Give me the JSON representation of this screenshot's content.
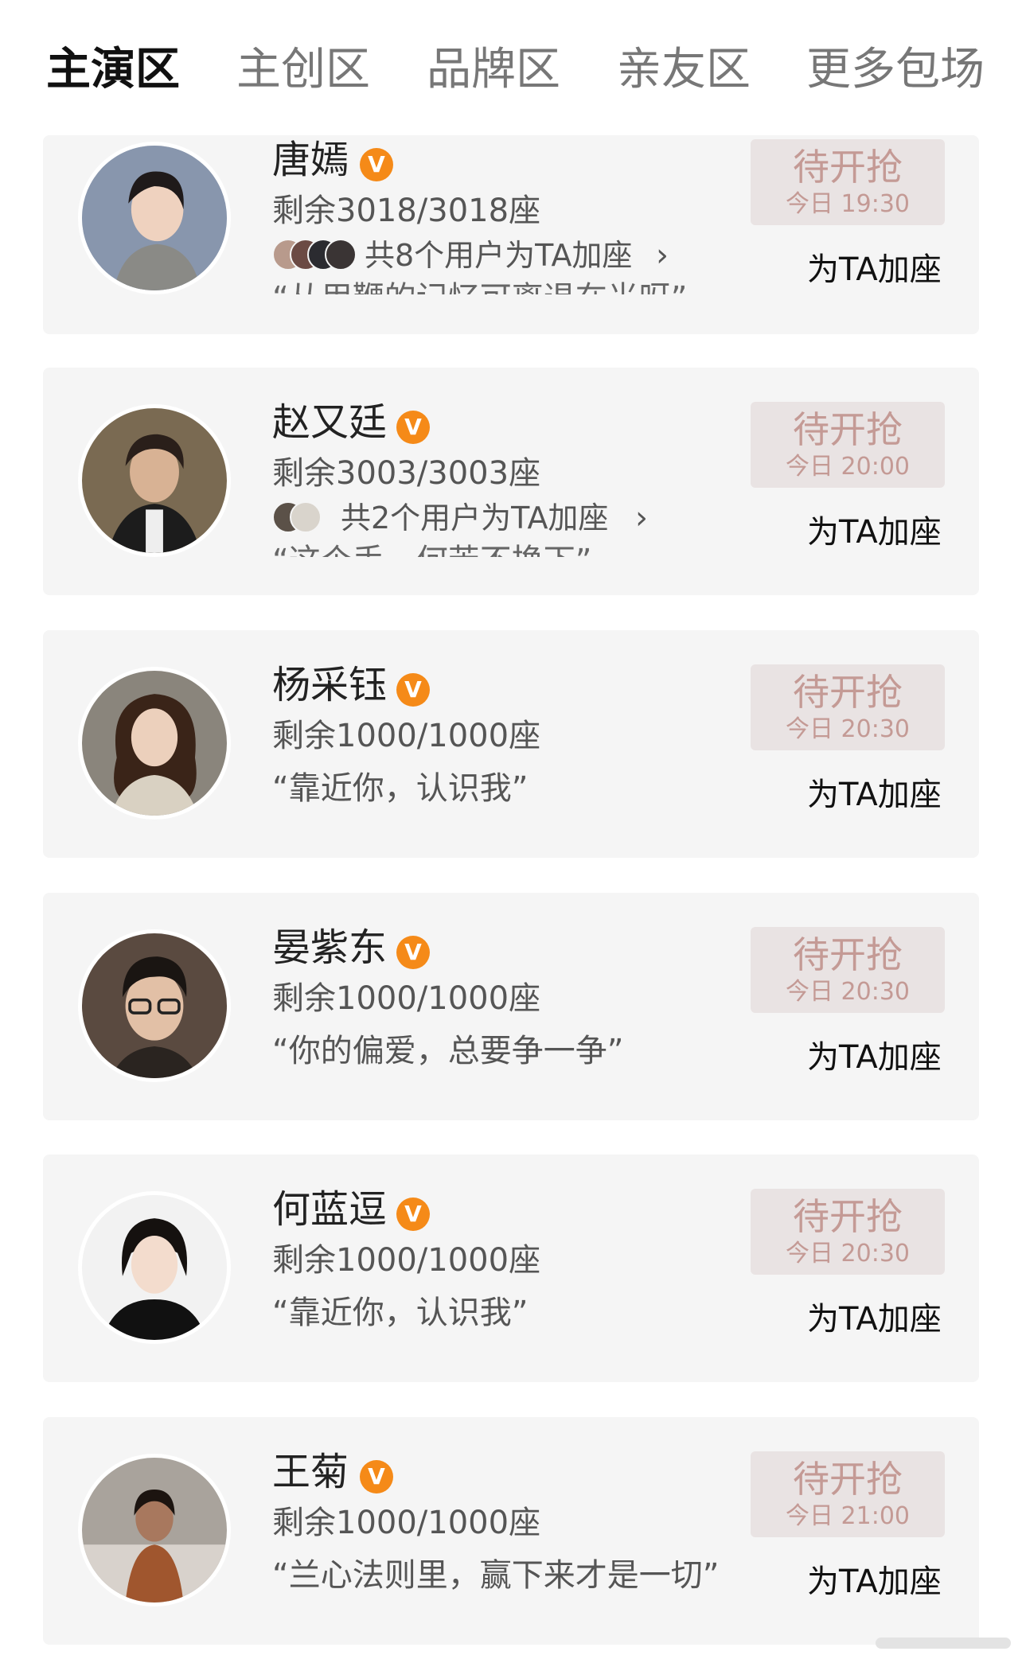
{
  "tabs": [
    "主演区",
    "主创区",
    "品牌区",
    "亲友区",
    "更多包场"
  ],
  "badge_glyph": "V",
  "accent_color": "#f58a18",
  "cards": [
    {
      "name": "唐嫣",
      "seats": "剩余3018/3018座",
      "users_text": "共8个用户为TA加座",
      "quote_cut": "“从用鞭的记忆可离退在光呀”",
      "status": "待开抢",
      "time": "今日 19:30",
      "action": "为TA加座"
    },
    {
      "name": "赵又廷",
      "seats": "剩余3003/3003座",
      "users_text": "共2个用户为TA加座",
      "quote_cut": "“这个手，何苦不换下”",
      "status": "待开抢",
      "time": "今日 20:00",
      "action": "为TA加座"
    },
    {
      "name": "杨采钰",
      "seats": "剩余1000/1000座",
      "quote": "“靠近你，认识我”",
      "status": "待开抢",
      "time": "今日 20:30",
      "action": "为TA加座"
    },
    {
      "name": "晏紫东",
      "seats": "剩余1000/1000座",
      "quote": "“你的偏爱，总要争一争”",
      "status": "待开抢",
      "time": "今日 20:30",
      "action": "为TA加座"
    },
    {
      "name": "何蓝逗",
      "seats": "剩余1000/1000座",
      "quote": "“靠近你，认识我”",
      "status": "待开抢",
      "time": "今日 20:30",
      "action": "为TA加座"
    },
    {
      "name": "王菊",
      "seats": "剩余1000/1000座",
      "quote": "“兰心法则里，赢下来才是一切”",
      "status": "待开抢",
      "time": "今日 21:00",
      "action": "为TA加座"
    }
  ]
}
